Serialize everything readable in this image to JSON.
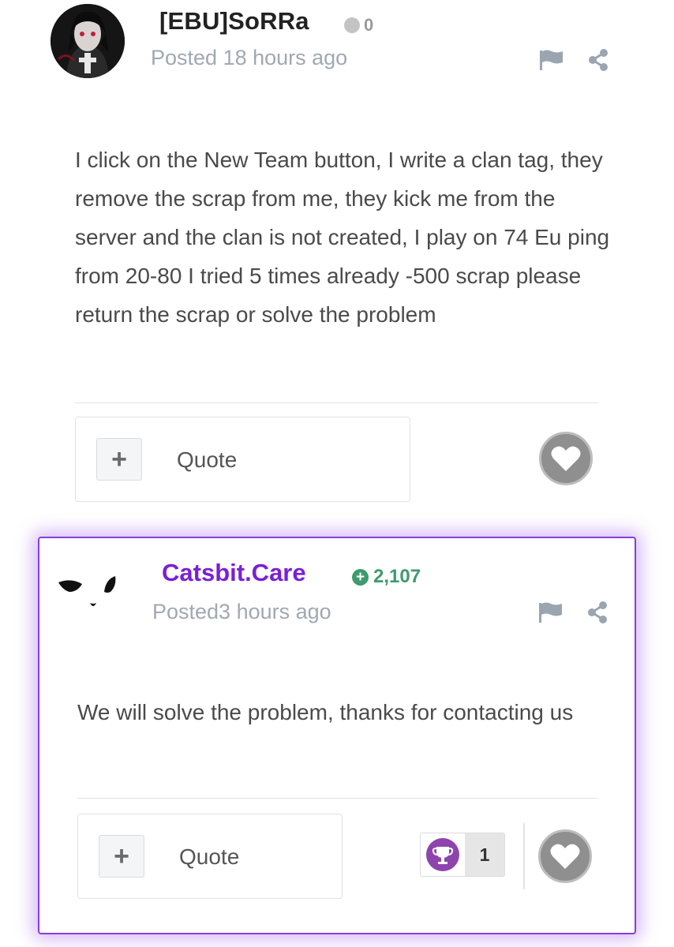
{
  "post1": {
    "username": "[EBU]SoRRa",
    "reputation": "0",
    "posted": "Posted 18 hours ago",
    "body": "I click on the New Team button, I write a clan tag, they remove the scrap from me, they kick me from the server and the clan is not created, I play on 74 Eu ping from 20-80 I tried 5 times already -500 scrap please return the scrap or solve the problem",
    "quote_label": "Quote",
    "plus_label": "+"
  },
  "post2": {
    "username": "Catsbit.Care",
    "reputation": "2,107",
    "posted": "Posted3 hours ago",
    "body": "We will solve the problem, thanks for contacting us",
    "quote_label": "Quote",
    "plus_label": "+",
    "reaction_count": "1",
    "reaction_icon": "trophy-icon"
  },
  "colors": {
    "accent_purple": "#7a1fd6",
    "reputation_green": "#3f9a6e",
    "muted_text": "#a0a8b2"
  }
}
